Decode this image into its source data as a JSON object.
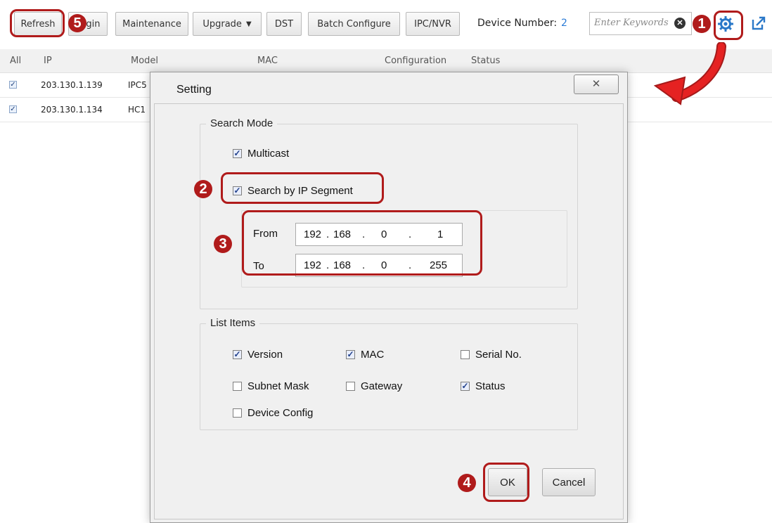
{
  "toolbar": {
    "buttons": [
      {
        "label": "Refresh"
      },
      {
        "label": "Login"
      },
      {
        "label": "Maintenance"
      },
      {
        "label": "Upgrade"
      },
      {
        "label": "DST"
      },
      {
        "label": "Batch Configure"
      },
      {
        "label": "IPC/NVR"
      }
    ],
    "device_number_label": "Device Number:",
    "device_number_value": "2",
    "search_placeholder": "Enter Keywords",
    "gear_icon": "gear-icon",
    "export_icon": "export-icon"
  },
  "table": {
    "headers": [
      "All",
      "IP",
      "Model",
      "MAC",
      "Configuration",
      "Status"
    ],
    "rows": [
      {
        "ip": "203.130.1.139",
        "model": "IPC5",
        "checked": true
      },
      {
        "ip": "203.130.1.134",
        "model": "HC1",
        "checked": true
      }
    ]
  },
  "dialog": {
    "title": "Setting",
    "close_glyph": "✕",
    "search_mode": {
      "title": "Search Mode",
      "multicast": {
        "label": "Multicast",
        "checked": true
      },
      "by_segment": {
        "label": "Search by IP Segment",
        "checked": true
      },
      "from_label": "From",
      "to_label": "To",
      "from_ip": [
        "192",
        "168",
        "0",
        "1"
      ],
      "to_ip": [
        "192",
        "168",
        "0",
        "255"
      ]
    },
    "list_items": {
      "title": "List Items",
      "version": {
        "label": "Version",
        "checked": true
      },
      "mac": {
        "label": "MAC",
        "checked": true
      },
      "serial": {
        "label": "Serial No.",
        "checked": false
      },
      "subnet": {
        "label": "Subnet Mask",
        "checked": false
      },
      "gateway": {
        "label": "Gateway",
        "checked": false
      },
      "status": {
        "label": "Status",
        "checked": true
      },
      "device_config": {
        "label": "Device Config",
        "checked": false
      }
    },
    "ok_label": "OK",
    "cancel_label": "Cancel"
  },
  "annotations": {
    "step1": "1",
    "step2": "2",
    "step3": "3",
    "step4": "4",
    "step5": "5",
    "color": "#b01b1b"
  }
}
